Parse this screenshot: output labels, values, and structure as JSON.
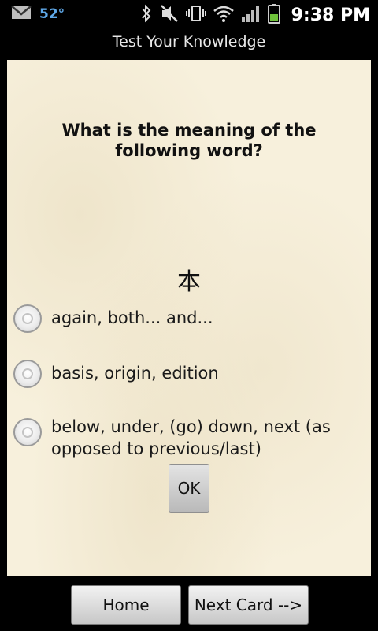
{
  "status_bar": {
    "temperature": "52°",
    "time": "9:38 PM",
    "icons": [
      "gmail-icon",
      "bluetooth-icon",
      "mute-icon",
      "vibrate-icon",
      "wifi-icon",
      "signal-icon",
      "battery-icon"
    ]
  },
  "title": "Test Your Knowledge",
  "question": "What is the meaning of the following word?",
  "word": "本",
  "options": [
    "again, both... and...",
    "basis, origin, edition",
    "below, under, (go) down, next (as opposed to previous/last)"
  ],
  "ok_label": "OK",
  "bottom": {
    "home_label": "Home",
    "next_label": "Next Card -->"
  },
  "colors": {
    "card_bg": "#f7f0dc",
    "temperature": "#5fa8e8",
    "battery": "#6fc23a"
  }
}
